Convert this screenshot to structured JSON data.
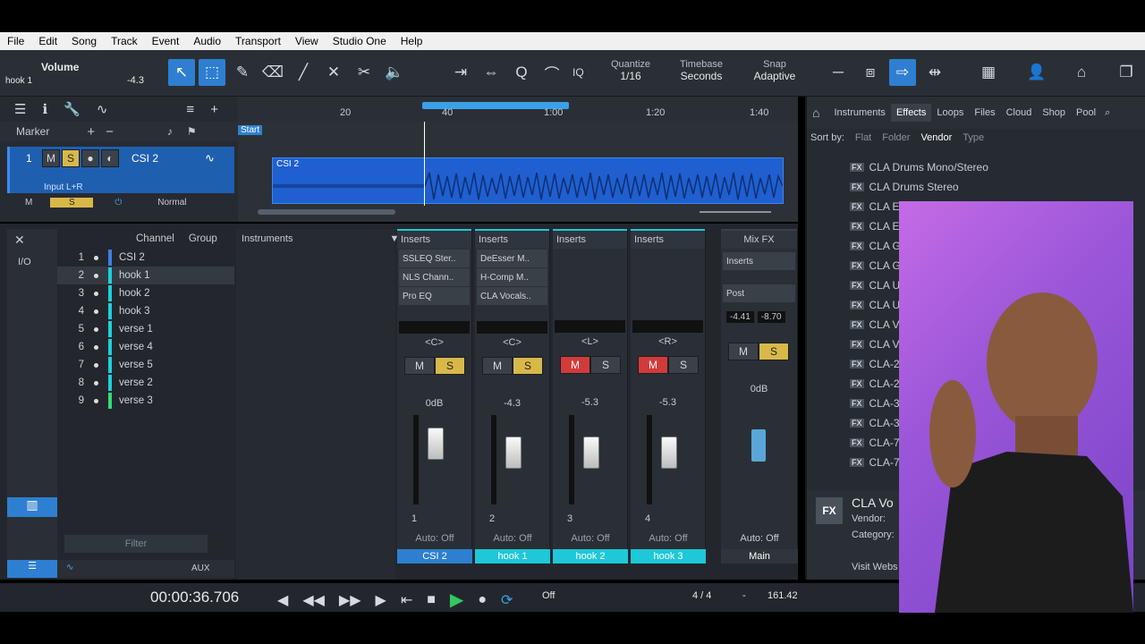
{
  "menu": [
    "File",
    "Edit",
    "Song",
    "Track",
    "Event",
    "Audio",
    "Transport",
    "View",
    "Studio One",
    "Help"
  ],
  "toolbar": {
    "param_name": "Volume",
    "track_name": "hook 1",
    "param_value": "-4.3",
    "quantize_label": "Quantize",
    "quantize_value": "1/16",
    "timebase_label": "Timebase",
    "timebase_value": "Seconds",
    "snap_label": "Snap",
    "snap_value": "Adaptive",
    "iq": "IQ"
  },
  "track_header": {
    "marker": "Marker",
    "track_num": "1",
    "track_name": "CSI 2",
    "input": "Input L+R",
    "mode": "Normal",
    "m": "M",
    "s": "S"
  },
  "timeline": {
    "ticks": [
      "20",
      "40",
      "1:00",
      "1:20",
      "1:40"
    ],
    "start": "Start",
    "clip": "CSI 2"
  },
  "browser": {
    "tabs": [
      "Instruments",
      "Effects",
      "Loops",
      "Files",
      "Cloud",
      "Shop",
      "Pool"
    ],
    "sort_by": "Sort by:",
    "sort_opts": [
      "Flat",
      "Folder",
      "Vendor",
      "Type"
    ],
    "items": [
      "CLA Drums Mono/Stereo",
      "CLA Drums Stereo",
      "CLA E",
      "CLA E",
      "CLA G",
      "CLA G",
      "CLA U",
      "CLA U",
      "CLA V",
      "CLA V",
      "CLA-2",
      "CLA-2",
      "CLA-3",
      "CLA-3",
      "CLA-7",
      "CLA-7"
    ],
    "detail_name": "CLA Vo",
    "detail_vendor": "Vendor:",
    "detail_category": "Category:",
    "visit": "Visit Webs"
  },
  "console": {
    "channel_header": "Channel",
    "group_header": "Group",
    "instruments": "Instruments",
    "io": "I/O",
    "filter": "Filter",
    "aux": "AUX",
    "channels": [
      {
        "num": "1",
        "name": "CSI 2",
        "color": "#3d7fe0"
      },
      {
        "num": "2",
        "name": "hook 1",
        "color": "#1ed0dc"
      },
      {
        "num": "3",
        "name": "hook 2",
        "color": "#1ed0dc"
      },
      {
        "num": "4",
        "name": "hook 3",
        "color": "#1ed0dc"
      },
      {
        "num": "5",
        "name": "verse 1",
        "color": "#1ed0dc"
      },
      {
        "num": "6",
        "name": "verse 4",
        "color": "#1ed0dc"
      },
      {
        "num": "7",
        "name": "verse 5",
        "color": "#1ed0dc"
      },
      {
        "num": "8",
        "name": "verse 2",
        "color": "#1ed0dc"
      },
      {
        "num": "9",
        "name": "verse 3",
        "color": "#33dc7a"
      }
    ],
    "strips": [
      {
        "name": "CSI 2",
        "num": "1",
        "inserts": [
          "SSLEQ Ster..",
          "NLS Chann..",
          "Pro EQ"
        ],
        "pan": "<C>",
        "vol": "0dB",
        "mute": false,
        "solo": true,
        "auto": "Auto: Off",
        "color": "#2e7fd1"
      },
      {
        "name": "hook 1",
        "num": "2",
        "inserts": [
          "DeEsser M..",
          "H-Comp M..",
          "CLA Vocals.."
        ],
        "pan": "<C>",
        "vol": "-4.3",
        "mute": false,
        "solo": true,
        "auto": "Auto: Off",
        "color": "#1ec8d8"
      },
      {
        "name": "hook 2",
        "num": "3",
        "inserts": [],
        "pan": "<L>",
        "vol": "-5.3",
        "mute": true,
        "solo": false,
        "auto": "Auto: Off",
        "color": "#1ec8d8"
      },
      {
        "name": "hook 3",
        "num": "4",
        "inserts": [],
        "pan": "<R>",
        "vol": "-5.3",
        "mute": true,
        "solo": false,
        "auto": "Auto: Off",
        "color": "#1ec8d8"
      }
    ],
    "inserts_label": "Inserts",
    "mixfx": "Mix FX",
    "post": "Post",
    "main_name": "Main",
    "main_vol": "0dB",
    "main_peak_l": "-4.41",
    "main_peak_r": "-8.70",
    "main_auto": "Auto: Off",
    "m": "M",
    "s": "S"
  },
  "transport": {
    "time": "00:00:36.706",
    "off": "Off",
    "signature": "4 / 4",
    "key": "-",
    "tempo": "161.42"
  }
}
